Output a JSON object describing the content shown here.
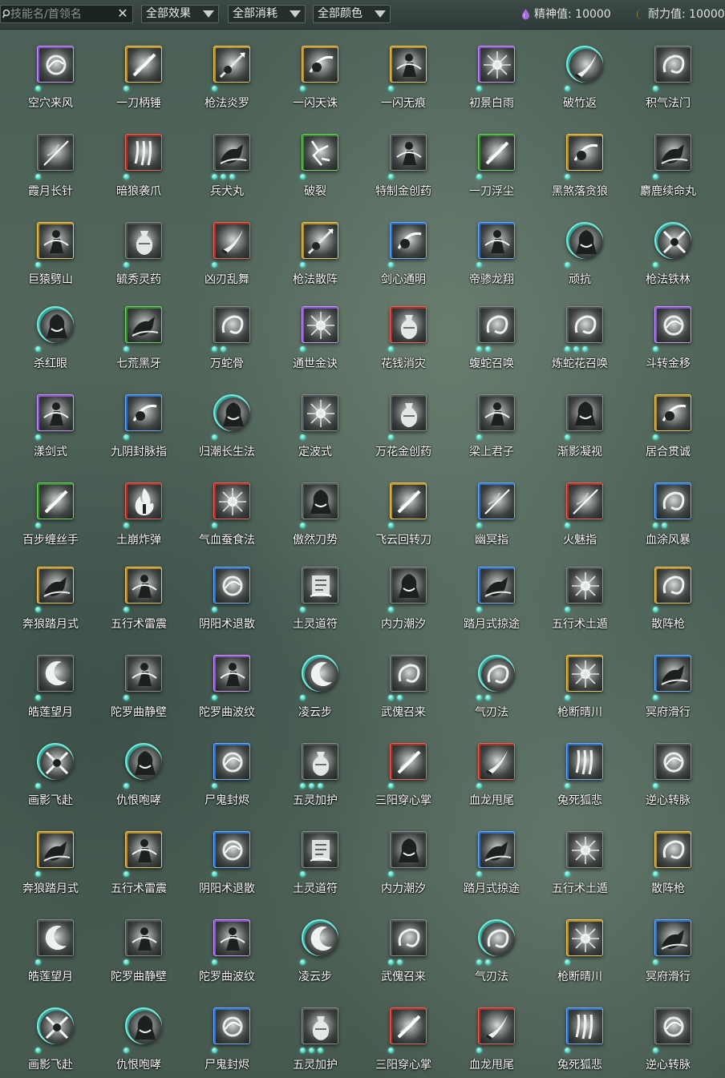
{
  "toolbar": {
    "search_placeholder": "技能名/首领名",
    "clear_label": "✕",
    "filters": [
      {
        "label": "全部效果"
      },
      {
        "label": "全部消耗"
      },
      {
        "label": "全部颜色"
      }
    ],
    "spirit_label": "精神值: 10000",
    "stamina_label": "耐力值: 10000",
    "colors": {
      "spirit": "#a46be0",
      "stamina": "#e0a14a",
      "dot": "#49d3bd"
    }
  },
  "rows": [
    [
      {
        "name": "空穴来风",
        "frame": "purple",
        "dots": 1,
        "icon": "whirl-icon"
      },
      {
        "name": "一刀柄锤",
        "frame": "gold",
        "dots": 1,
        "icon": "slash-icon"
      },
      {
        "name": "枪法炎罗",
        "frame": "gold",
        "dots": 1,
        "icon": "spear-icon"
      },
      {
        "name": "一闪天诛",
        "frame": "gold",
        "dots": 1,
        "icon": "strike-icon"
      },
      {
        "name": "一闪无痕",
        "frame": "gold",
        "dots": 1,
        "icon": "figure-icon"
      },
      {
        "name": "初景白雨",
        "frame": "purple",
        "dots": 1,
        "icon": "burst-icon"
      },
      {
        "name": "破竹返",
        "frame": "teal",
        "dots": 1,
        "icon": "blade-icon"
      },
      {
        "name": "积气法门",
        "frame": "gray",
        "dots": 1,
        "icon": "swirl-icon"
      }
    ],
    [
      {
        "name": "霞月长针",
        "frame": "gray",
        "dots": 1,
        "icon": "needle-icon"
      },
      {
        "name": "暗狼袭爪",
        "frame": "red",
        "dots": 1,
        "icon": "claw-icon"
      },
      {
        "name": "兵犬丸",
        "frame": "gray",
        "dots": 3,
        "icon": "beast-icon"
      },
      {
        "name": "破裂",
        "frame": "green",
        "dots": 1,
        "icon": "crack-icon"
      },
      {
        "name": "特制金创药",
        "frame": "gray",
        "dots": 1,
        "icon": "figure-icon"
      },
      {
        "name": "一刀浮尘",
        "frame": "green",
        "dots": 1,
        "icon": "slash-icon"
      },
      {
        "name": "黑煞落贪狼",
        "frame": "gold",
        "dots": 1,
        "icon": "strike-icon"
      },
      {
        "name": "麝鹿续命丸",
        "frame": "gray",
        "dots": 1,
        "icon": "beast-icon"
      }
    ],
    [
      {
        "name": "巨猿劈山",
        "frame": "gold",
        "dots": 1,
        "icon": "figure-icon"
      },
      {
        "name": "毓秀灵药",
        "frame": "gray",
        "dots": 1,
        "icon": "vase-icon"
      },
      {
        "name": "凶刃乱舞",
        "frame": "red",
        "dots": 1,
        "icon": "blade-icon"
      },
      {
        "name": "枪法散阵",
        "frame": "gold",
        "dots": 1,
        "icon": "spear-icon"
      },
      {
        "name": "剑心通明",
        "frame": "blue",
        "dots": 1,
        "icon": "strike-icon"
      },
      {
        "name": "帝骖龙翔",
        "frame": "blue",
        "dots": 1,
        "icon": "figure-icon"
      },
      {
        "name": "顽抗",
        "frame": "teal",
        "dots": 1,
        "icon": "hood-icon"
      },
      {
        "name": "枪法铁林",
        "frame": "teal",
        "dots": 1,
        "icon": "cross-icon"
      }
    ],
    [
      {
        "name": "杀红眼",
        "frame": "teal",
        "dots": 1,
        "icon": "hood-icon"
      },
      {
        "name": "七荒黑牙",
        "frame": "green",
        "dots": 1,
        "icon": "beast-icon"
      },
      {
        "name": "万蛇骨",
        "frame": "gray",
        "dots": 2,
        "icon": "swirl-icon"
      },
      {
        "name": "通世金诀",
        "frame": "purple",
        "dots": 1,
        "icon": "burst-icon"
      },
      {
        "name": "花钱消灾",
        "frame": "red",
        "dots": 1,
        "icon": "vase-icon"
      },
      {
        "name": "蝮蛇召唤",
        "frame": "gray",
        "dots": 2,
        "icon": "swirl-icon"
      },
      {
        "name": "炼蛇花召唤",
        "frame": "gray",
        "dots": 3,
        "icon": "swirl-icon"
      },
      {
        "name": "斗转金移",
        "frame": "purple",
        "dots": 1,
        "icon": "whirl-icon"
      }
    ],
    [
      {
        "name": "漾剑式",
        "frame": "purple",
        "dots": 1,
        "icon": "figure-icon"
      },
      {
        "name": "九阴封脉指",
        "frame": "blue",
        "dots": 1,
        "icon": "strike-icon"
      },
      {
        "name": "归潮长生法",
        "frame": "teal",
        "dots": 1,
        "icon": "hood-icon"
      },
      {
        "name": "定波式",
        "frame": "gray",
        "dots": 1,
        "icon": "burst-icon"
      },
      {
        "name": "万花金创药",
        "frame": "gray",
        "dots": 1,
        "icon": "vase-icon"
      },
      {
        "name": "梁上君子",
        "frame": "gray",
        "dots": 1,
        "icon": "figure-icon"
      },
      {
        "name": "渐影凝视",
        "frame": "gray",
        "dots": 1,
        "icon": "hood-icon"
      },
      {
        "name": "居合贯诚",
        "frame": "gold",
        "dots": 1,
        "icon": "strike-icon"
      }
    ],
    [
      {
        "name": "百步缠丝手",
        "frame": "green",
        "dots": 1,
        "icon": "slash-icon"
      },
      {
        "name": "土崩炸弹",
        "frame": "red",
        "dots": 1,
        "icon": "fire-icon"
      },
      {
        "name": "气血蚕食法",
        "frame": "red",
        "dots": 1,
        "icon": "burst-icon"
      },
      {
        "name": "傲然刀势",
        "frame": "gray",
        "dots": 1,
        "icon": "hood-icon"
      },
      {
        "name": "飞云回转刀",
        "frame": "gold",
        "dots": 1,
        "icon": "slash-icon"
      },
      {
        "name": "幽冥指",
        "frame": "blue",
        "dots": 1,
        "icon": "needle-icon"
      },
      {
        "name": "火魅指",
        "frame": "red",
        "dots": 1,
        "icon": "needle-icon"
      },
      {
        "name": "血涂风暴",
        "frame": "blue",
        "dots": 2,
        "icon": "swirl-icon"
      }
    ],
    [
      {
        "name": "奔狼踏月式",
        "frame": "gold",
        "dots": 1,
        "icon": "beast-icon"
      },
      {
        "name": "五行术雷震",
        "frame": "gold",
        "dots": 1,
        "icon": "figure-icon"
      },
      {
        "name": "阴阳术退散",
        "frame": "blue",
        "dots": 1,
        "icon": "whirl-icon"
      },
      {
        "name": "土灵道符",
        "frame": "gray",
        "dots": 1,
        "icon": "scroll-icon"
      },
      {
        "name": "内力潮汐",
        "frame": "gray",
        "dots": 1,
        "icon": "hood-icon"
      },
      {
        "name": "踏月式掠途",
        "frame": "blue",
        "dots": 1,
        "icon": "beast-icon"
      },
      {
        "name": "五行术土遁",
        "frame": "gray",
        "dots": 1,
        "icon": "burst-icon"
      },
      {
        "name": "散阵枪",
        "frame": "gold",
        "dots": 1,
        "icon": "swirl-icon"
      }
    ],
    [
      {
        "name": "皓莲望月",
        "frame": "gray",
        "dots": 1,
        "icon": "moon-icon"
      },
      {
        "name": "陀罗曲静壁",
        "frame": "gray",
        "dots": 1,
        "icon": "figure-icon"
      },
      {
        "name": "陀罗曲波纹",
        "frame": "purple",
        "dots": 1,
        "icon": "figure-icon"
      },
      {
        "name": "凌云步",
        "frame": "teal",
        "dots": 1,
        "icon": "moon-icon"
      },
      {
        "name": "武傀召来",
        "frame": "gray",
        "dots": 2,
        "icon": "swirl-icon"
      },
      {
        "name": "气刃法",
        "frame": "teal",
        "dots": 2,
        "icon": "swirl-icon"
      },
      {
        "name": "枪断晴川",
        "frame": "gold",
        "dots": 1,
        "icon": "burst-icon"
      },
      {
        "name": "冥府滑行",
        "frame": "blue",
        "dots": 1,
        "icon": "beast-icon"
      }
    ],
    [
      {
        "name": "画影飞赴",
        "frame": "teal",
        "dots": 1,
        "icon": "cross-icon"
      },
      {
        "name": "仇恨咆哮",
        "frame": "teal",
        "dots": 1,
        "icon": "hood-icon"
      },
      {
        "name": "尸鬼封烬",
        "frame": "blue",
        "dots": 1,
        "icon": "whirl-icon"
      },
      {
        "name": "五灵加护",
        "frame": "gray",
        "dots": 3,
        "icon": "vase-icon"
      },
      {
        "name": "三阳穿心掌",
        "frame": "red",
        "dots": 1,
        "icon": "slash-icon"
      },
      {
        "name": "血龙甩尾",
        "frame": "red",
        "dots": 1,
        "icon": "blade-icon"
      },
      {
        "name": "兔死狐悲",
        "frame": "blue",
        "dots": 1,
        "icon": "claw-icon"
      },
      {
        "name": "逆心转脉",
        "frame": "gray",
        "dots": 1,
        "icon": "whirl-icon"
      }
    ],
    [
      {
        "name": "奔狼踏月式",
        "frame": "gold",
        "dots": 1,
        "icon": "beast-icon"
      },
      {
        "name": "五行术雷震",
        "frame": "gold",
        "dots": 1,
        "icon": "figure-icon"
      },
      {
        "name": "阴阳术退散",
        "frame": "blue",
        "dots": 1,
        "icon": "whirl-icon"
      },
      {
        "name": "土灵道符",
        "frame": "gray",
        "dots": 1,
        "icon": "scroll-icon"
      },
      {
        "name": "内力潮汐",
        "frame": "gray",
        "dots": 1,
        "icon": "hood-icon"
      },
      {
        "name": "踏月式掠途",
        "frame": "blue",
        "dots": 1,
        "icon": "beast-icon"
      },
      {
        "name": "五行术土遁",
        "frame": "gray",
        "dots": 1,
        "icon": "burst-icon"
      },
      {
        "name": "散阵枪",
        "frame": "gold",
        "dots": 1,
        "icon": "swirl-icon"
      }
    ],
    [
      {
        "name": "皓莲望月",
        "frame": "gray",
        "dots": 1,
        "icon": "moon-icon"
      },
      {
        "name": "陀罗曲静壁",
        "frame": "gray",
        "dots": 1,
        "icon": "figure-icon"
      },
      {
        "name": "陀罗曲波纹",
        "frame": "purple",
        "dots": 1,
        "icon": "figure-icon"
      },
      {
        "name": "凌云步",
        "frame": "teal",
        "dots": 1,
        "icon": "moon-icon"
      },
      {
        "name": "武傀召来",
        "frame": "gray",
        "dots": 2,
        "icon": "swirl-icon"
      },
      {
        "name": "气刃法",
        "frame": "teal",
        "dots": 2,
        "icon": "swirl-icon"
      },
      {
        "name": "枪断晴川",
        "frame": "gold",
        "dots": 1,
        "icon": "burst-icon"
      },
      {
        "name": "冥府滑行",
        "frame": "blue",
        "dots": 1,
        "icon": "beast-icon"
      }
    ],
    [
      {
        "name": "画影飞赴",
        "frame": "teal",
        "dots": 1,
        "icon": "cross-icon"
      },
      {
        "name": "仇恨咆哮",
        "frame": "teal",
        "dots": 1,
        "icon": "hood-icon"
      },
      {
        "name": "尸鬼封烬",
        "frame": "blue",
        "dots": 1,
        "icon": "whirl-icon"
      },
      {
        "name": "五灵加护",
        "frame": "gray",
        "dots": 3,
        "icon": "vase-icon"
      },
      {
        "name": "三阳穿心掌",
        "frame": "red",
        "dots": 1,
        "icon": "slash-icon"
      },
      {
        "name": "血龙甩尾",
        "frame": "red",
        "dots": 1,
        "icon": "blade-icon"
      },
      {
        "name": "兔死狐悲",
        "frame": "blue",
        "dots": 1,
        "icon": "claw-icon"
      },
      {
        "name": "逆心转脉",
        "frame": "gray",
        "dots": 1,
        "icon": "whirl-icon"
      }
    ]
  ]
}
